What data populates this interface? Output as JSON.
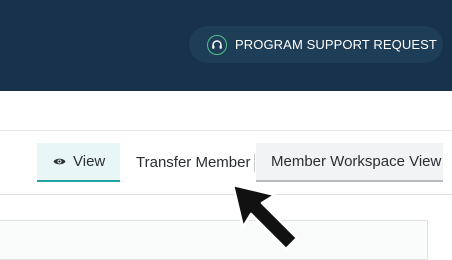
{
  "header": {
    "support_button_label": "PROGRAM SUPPORT REQUEST",
    "support_icon": "headset-icon"
  },
  "tabs": [
    {
      "label": "View",
      "icon": "eye-icon",
      "active": true
    },
    {
      "label": "Transfer Member",
      "active": false
    },
    {
      "label": "Member Workspace View",
      "active": false
    }
  ],
  "colors": {
    "header_bg": "#17324a",
    "accent": "#21a3a3",
    "support_icon": "#4fc08d"
  }
}
